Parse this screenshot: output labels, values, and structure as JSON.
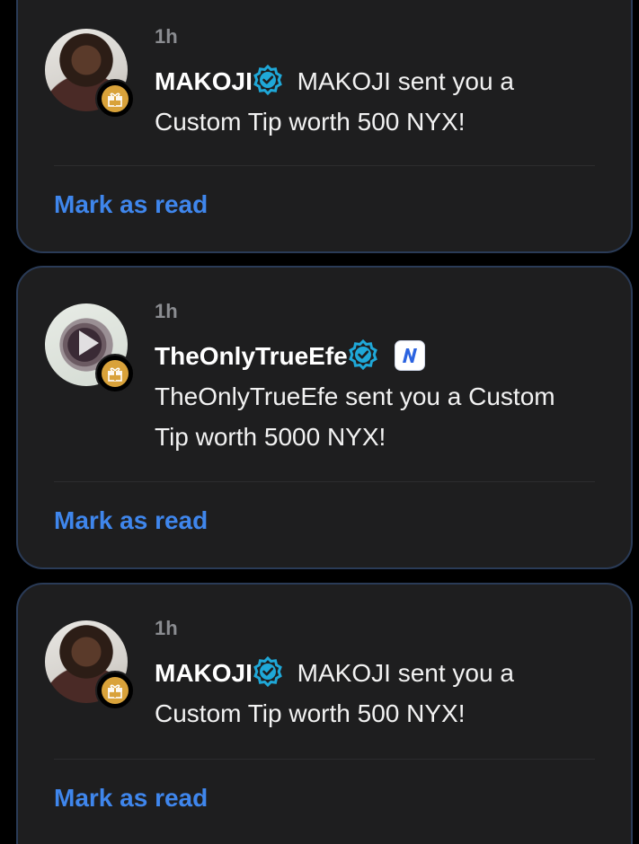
{
  "notifications": [
    {
      "time": "1h",
      "username": "MAKOJI",
      "message_line1": " MAKOJI sent you a",
      "message_line2": "Custom Tip worth 500 NYX!",
      "action_label": "Mark as read"
    },
    {
      "time": "1h",
      "username": "TheOnlyTrueEfe",
      "message_line1": "TheOnlyTrueEfe sent you a Custom",
      "message_line2": "Tip worth 5000 NYX!",
      "action_label": "Mark as read"
    },
    {
      "time": "1h",
      "username": "MAKOJI",
      "message_line1": " MAKOJI sent you a",
      "message_line2": "Custom Tip worth 500 NYX!",
      "action_label": "Mark as read"
    }
  ],
  "icons": {
    "verified": "verified-badge-icon",
    "gift": "gift-icon",
    "nyx": "nyx-logo-icon"
  },
  "colors": {
    "card_background": "#1e1e1f",
    "card_border": "#2a3b57",
    "link": "#3f86ec",
    "verified": "#1fa8d8",
    "gift_badge": "#d9a23a"
  }
}
